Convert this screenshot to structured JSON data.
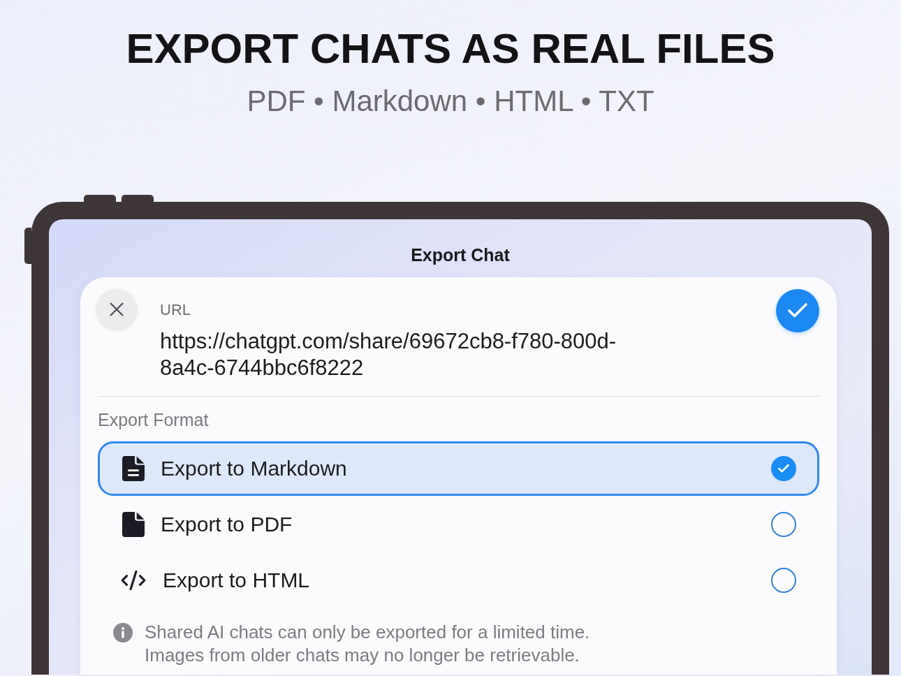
{
  "headline": {
    "title": "EXPORT CHATS AS REAL FILES",
    "subtitle": "PDF • Markdown • HTML • TXT"
  },
  "sheet": {
    "title": "Export Chat",
    "url": {
      "label": "URL",
      "value": "https://chatgpt.com/share/69672cb8-f780-800d-8a4c-6744bbc6f8222"
    },
    "format_label": "Export Format",
    "options": [
      {
        "kind": "markdown",
        "label": "Export to Markdown",
        "selected": true
      },
      {
        "kind": "pdf",
        "label": "Export to PDF",
        "selected": false
      },
      {
        "kind": "html",
        "label": "Export to HTML",
        "selected": false
      }
    ],
    "notice": "Shared AI chats can only be exported for a limited time. Images from older chats may no longer be retrievable."
  }
}
